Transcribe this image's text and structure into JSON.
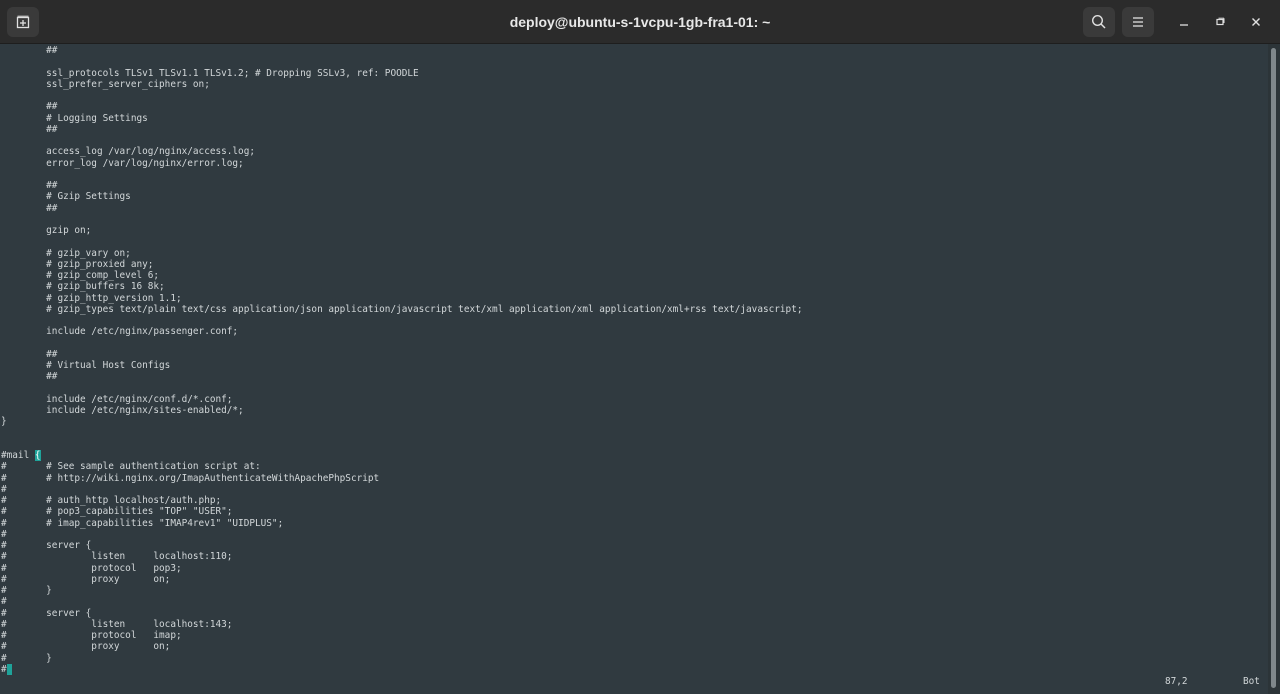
{
  "window": {
    "title": "deploy@ubuntu-s-1vcpu-1gb-fra1-01: ~",
    "buttons": [
      "new-tab-icon",
      "search-icon",
      "hamburger-menu-icon",
      "minimize-icon",
      "maximize-icon",
      "close-icon"
    ]
  },
  "terminal": {
    "lines": [
      "        ##",
      "",
      "        ssl_protocols TLSv1 TLSv1.1 TLSv1.2; # Dropping SSLv3, ref: POODLE",
      "        ssl_prefer_server_ciphers on;",
      "",
      "        ##",
      "        # Logging Settings",
      "        ##",
      "",
      "        access_log /var/log/nginx/access.log;",
      "        error_log /var/log/nginx/error.log;",
      "",
      "        ##",
      "        # Gzip Settings",
      "        ##",
      "",
      "        gzip on;",
      "",
      "        # gzip_vary on;",
      "        # gzip_proxied any;",
      "        # gzip_comp_level 6;",
      "        # gzip_buffers 16 8k;",
      "        # gzip_http_version 1.1;",
      "        # gzip_types text/plain text/css application/json application/javascript text/xml application/xml application/xml+rss text/javascript;",
      "",
      "        include /etc/nginx/passenger.conf;",
      "",
      "        ##",
      "        # Virtual Host Configs",
      "        ##",
      "",
      "        include /etc/nginx/conf.d/*.conf;",
      "        include /etc/nginx/sites-enabled/*;",
      "}",
      "",
      "",
      "#mail ",
      "#       # See sample authentication script at:",
      "#       # http://wiki.nginx.org/ImapAuthenticateWithApachePhpScript",
      "#",
      "#       # auth_http localhost/auth.php;",
      "#       # pop3_capabilities \"TOP\" \"USER\";",
      "#       # imap_capabilities \"IMAP4rev1\" \"UIDPLUS\";",
      "#",
      "#       server {",
      "#               listen     localhost:110;",
      "#               protocol   pop3;",
      "#               proxy      on;",
      "#       }",
      "#",
      "#       server {",
      "#               listen     localhost:143;",
      "#               protocol   imap;",
      "#               proxy      on;",
      "#       }",
      "#"
    ],
    "mail_brace": "{",
    "last_line_cursor_char": "}"
  },
  "statusline": {
    "position": "87,2",
    "scroll": "Bot"
  },
  "colors": {
    "background": "#303a40",
    "text": "#d2d7d9",
    "cursor": "#1fa39a",
    "titlebar": "#2b2b2b"
  }
}
